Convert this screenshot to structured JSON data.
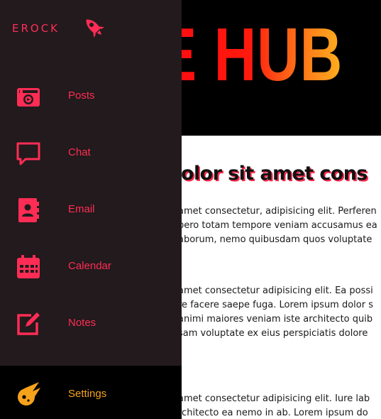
{
  "colors": {
    "accent": "#ff2d55",
    "settings_accent": "#f6a21b",
    "sidebar_bg": "#221a1c"
  },
  "brand": {
    "name": "EROCK",
    "logo_icon": "rocket-icon"
  },
  "nav": {
    "items": [
      {
        "label": "Posts",
        "icon": "camera-icon"
      },
      {
        "label": "Chat",
        "icon": "chat-bubble-icon"
      },
      {
        "label": "Email",
        "icon": "contact-book-icon"
      },
      {
        "label": "Calendar",
        "icon": "calendar-icon"
      },
      {
        "label": "Notes",
        "icon": "edit-note-icon"
      }
    ],
    "settings": {
      "label": "Settings",
      "icon": "meteor-icon"
    }
  },
  "hero": {
    "title": "E HUB"
  },
  "article": {
    "heading": "m dolor sit amet cons",
    "paragraphs": [
      [
        "amet consectetur, adipisicing elit. Perferen",
        "bero totam tempore veniam accusamus ea",
        "aborum, nemo quibusdam quos voluptate"
      ],
      [
        "amet consectetur adipisicing elit. Ea possi",
        "re facere saepe fuga. Lorem ipsum dolor s",
        "animi maiores veniam iste architecto quib",
        "sam voluptate ex eius perspiciatis dolore"
      ],
      [
        "amet consectetur adipisicing elit. Iure lab",
        "rchitecto ea nemo in ab. Lorem ipsum do"
      ]
    ]
  }
}
